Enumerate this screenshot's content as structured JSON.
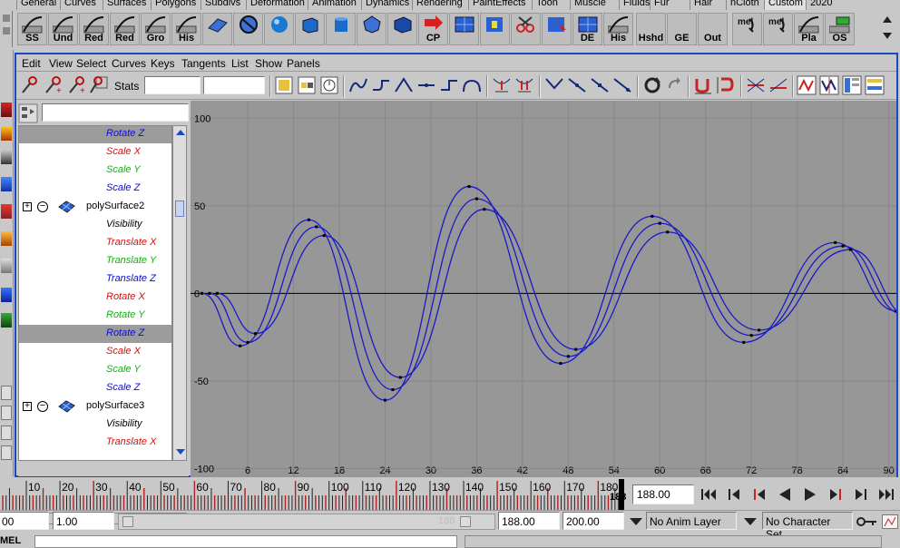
{
  "shelf_tabs": [
    "General",
    "Curves",
    "Surfaces",
    "Polygons",
    "Subdivs",
    "Deformation",
    "Animation",
    "Dynamics",
    "Rendering",
    "PaintEffects",
    "Toon",
    "Muscle",
    "Fluids",
    "Fur",
    "Hair",
    "nCloth",
    "Custom",
    "2020"
  ],
  "shelf_buttons": [
    {
      "label": "SS",
      "icon": "curve-tool-icon"
    },
    {
      "label": "Und",
      "icon": "curve-tool-icon"
    },
    {
      "label": "Red",
      "icon": "curve-tool-icon"
    },
    {
      "label": "Red",
      "icon": "curve-tool-icon"
    },
    {
      "label": "Gro",
      "icon": "curve-tool-icon"
    },
    {
      "label": "His",
      "icon": "curve-tool-icon"
    },
    {
      "label": "",
      "icon": "plane-icon"
    },
    {
      "label": "",
      "icon": "sphere-wire-icon"
    },
    {
      "label": "",
      "icon": "sphere-icon"
    },
    {
      "label": "",
      "icon": "cube-icon"
    },
    {
      "label": "",
      "icon": "cylinder-icon"
    },
    {
      "label": "",
      "icon": "polysphere-icon"
    },
    {
      "label": "",
      "icon": "polycube-icon"
    },
    {
      "label": "CP",
      "icon": "arrow-icon"
    },
    {
      "label": "",
      "icon": "grid-icon"
    },
    {
      "label": "",
      "icon": "uv-icon"
    },
    {
      "label": "",
      "icon": "scissors-icon"
    },
    {
      "label": "",
      "icon": "uv-select-icon"
    },
    {
      "label": "DE",
      "icon": "grid-icon"
    },
    {
      "label": "His",
      "icon": "curve-tool-icon"
    },
    {
      "label": "Hshd",
      "icon": "blank-icon"
    },
    {
      "label": "GE",
      "icon": "blank-icon"
    },
    {
      "label": "Out",
      "icon": "blank-icon"
    },
    {
      "label": "",
      "icon": "mel-icon",
      "overlay": "mel"
    },
    {
      "label": "",
      "icon": "mel-icon",
      "overlay": "mel"
    },
    {
      "label": "Pla",
      "icon": "curve-tool-icon"
    },
    {
      "label": "OS",
      "icon": "gear-icon"
    }
  ],
  "menu": [
    "Edit",
    "View",
    "Select",
    "Curves",
    "Keys",
    "Tangents",
    "List",
    "Show",
    "Panels"
  ],
  "stats_label": "Stats",
  "outliner": {
    "rows": [
      {
        "type": "attr",
        "label": "Rotate Z",
        "color": "#0b0bd0",
        "selected": true
      },
      {
        "type": "attr",
        "label": "Scale X",
        "color": "#d01010"
      },
      {
        "type": "attr",
        "label": "Scale Y",
        "color": "#10b010"
      },
      {
        "type": "attr",
        "label": "Scale Z",
        "color": "#0b0bd0"
      },
      {
        "type": "node",
        "label": "polySurface2"
      },
      {
        "type": "attr",
        "label": "Visibility",
        "color": "#000000"
      },
      {
        "type": "attr",
        "label": "Translate X",
        "color": "#d01010"
      },
      {
        "type": "attr",
        "label": "Translate Y",
        "color": "#10b010"
      },
      {
        "type": "attr",
        "label": "Translate Z",
        "color": "#0b0bd0"
      },
      {
        "type": "attr",
        "label": "Rotate X",
        "color": "#d01010"
      },
      {
        "type": "attr",
        "label": "Rotate Y",
        "color": "#10b010"
      },
      {
        "type": "attr",
        "label": "Rotate Z",
        "color": "#0b0bd0",
        "selected": true
      },
      {
        "type": "attr",
        "label": "Scale X",
        "color": "#d01010"
      },
      {
        "type": "attr",
        "label": "Scale Y",
        "color": "#10b010"
      },
      {
        "type": "attr",
        "label": "Scale Z",
        "color": "#0b0bd0"
      },
      {
        "type": "node",
        "label": "polySurface3"
      },
      {
        "type": "attr",
        "label": "Visibility",
        "color": "#000000"
      },
      {
        "type": "attr",
        "label": "Translate X",
        "color": "#d01010"
      }
    ],
    "scroll_left": "<<",
    "scroll_right": ">>"
  },
  "chart_data": {
    "type": "line",
    "x_ticks": [
      6,
      12,
      18,
      24,
      30,
      36,
      42,
      48,
      54,
      60,
      66,
      72,
      78,
      84,
      90
    ],
    "x_tick_labels": [
      "6",
      "12",
      "18",
      "24",
      "30",
      "36",
      "42",
      "48",
      "54",
      "60",
      "66",
      "72",
      "78",
      "84",
      "90"
    ],
    "y_ticks": [
      100,
      50,
      0,
      -50,
      -100
    ],
    "y_tick_labels": [
      "100",
      "50",
      "0",
      "-50",
      "-100"
    ],
    "xlim": [
      -1.5,
      91
    ],
    "ylim": [
      -105,
      110
    ],
    "grid": true,
    "series": [
      {
        "points": [
          [
            0,
            0
          ],
          [
            5,
            -30
          ],
          [
            14,
            42
          ],
          [
            24,
            -61
          ],
          [
            35,
            61
          ],
          [
            47,
            -40
          ],
          [
            59,
            44
          ],
          [
            71,
            -28
          ],
          [
            83,
            29
          ],
          [
            91,
            -10
          ]
        ]
      },
      {
        "points": [
          [
            1,
            0
          ],
          [
            6,
            -28
          ],
          [
            15,
            38
          ],
          [
            25,
            -55
          ],
          [
            36,
            54
          ],
          [
            48,
            -36
          ],
          [
            60,
            40
          ],
          [
            72,
            -24
          ],
          [
            84,
            27
          ],
          [
            92,
            -12
          ]
        ]
      },
      {
        "points": [
          [
            2,
            0
          ],
          [
            7,
            -23
          ],
          [
            16,
            33
          ],
          [
            26,
            -48
          ],
          [
            37,
            48
          ],
          [
            49,
            -32
          ],
          [
            61,
            35
          ],
          [
            73,
            -21
          ],
          [
            85,
            25
          ],
          [
            93,
            -14
          ]
        ]
      }
    ],
    "curve_color": "#1a1ac8"
  },
  "timeline": {
    "tick_labels": [
      "10",
      "20",
      "30",
      "40",
      "50",
      "60",
      "70",
      "80",
      "90",
      "100",
      "110",
      "120",
      "130",
      "140",
      "150",
      "160",
      "170",
      "180"
    ],
    "current_marker": "188",
    "current_frame": "188.00"
  },
  "range": {
    "start_left": "00",
    "start": "1.00",
    "range_end_ghost": "188",
    "end": "188.00",
    "end_total": "200.00",
    "anim_layer": "No Anim Layer",
    "character_set": "No Character Set"
  },
  "command_line": {
    "label": "MEL"
  }
}
